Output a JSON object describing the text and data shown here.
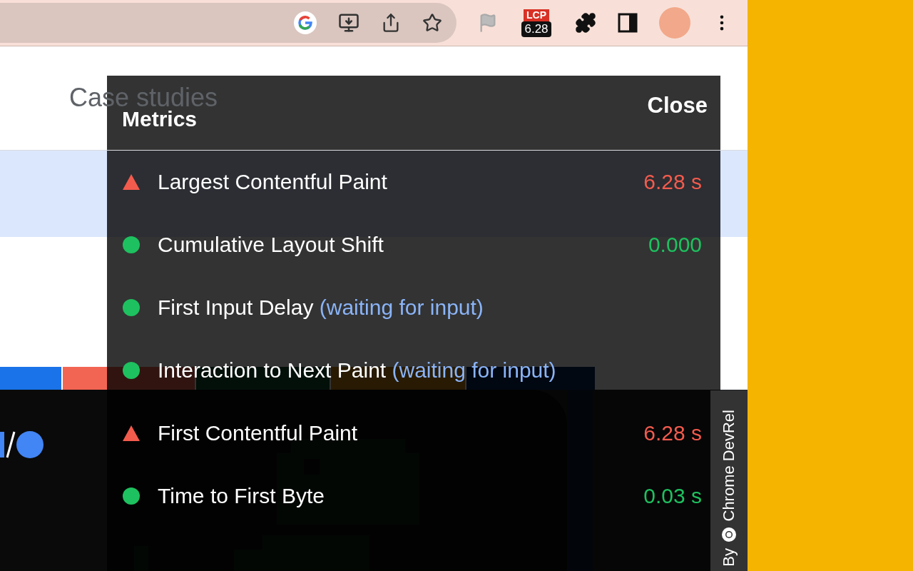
{
  "toolbar": {
    "badge": {
      "label": "LCP",
      "value": "6.28"
    }
  },
  "page": {
    "heading": "Case studies"
  },
  "panel": {
    "title": "Metrics",
    "close": "Close",
    "metrics": [
      {
        "name": "Largest Contentful Paint",
        "warning": true,
        "value": "6.28 s"
      },
      {
        "name": "Cumulative Layout Shift",
        "warning": false,
        "value": "0.000"
      },
      {
        "name": "First Input Delay",
        "warning": false,
        "note": "(waiting for input)"
      },
      {
        "name": "Interaction to Next Paint",
        "warning": false,
        "note": "(waiting for input)"
      },
      {
        "name": "First Contentful Paint",
        "warning": true,
        "value": "6.28 s"
      },
      {
        "name": "Time to First Byte",
        "warning": false,
        "value": "0.03 s"
      }
    ]
  },
  "credit": {
    "prefix": "By",
    "name": "Chrome DevRel"
  }
}
